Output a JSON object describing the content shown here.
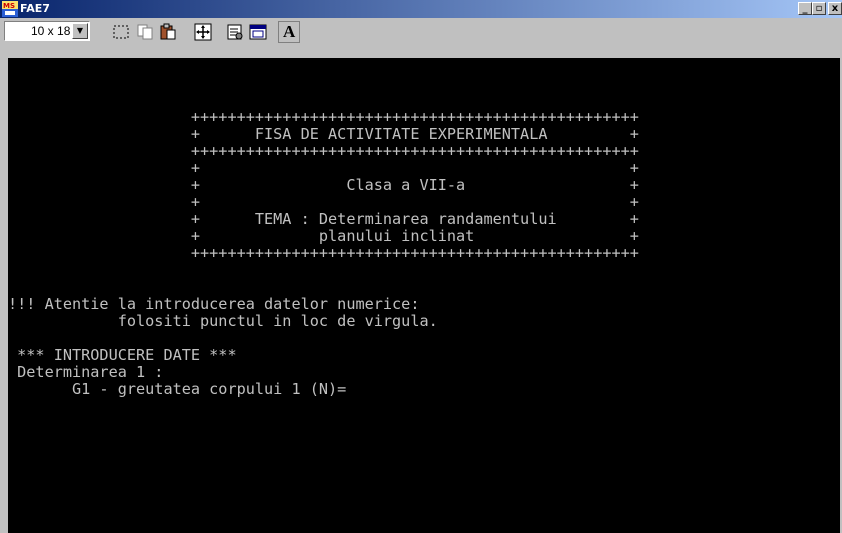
{
  "window": {
    "title": "FAE7",
    "icon_text": "MS"
  },
  "controls": {
    "minimize": "_",
    "maximize": "▫",
    "close": "x"
  },
  "toolbar": {
    "font_size": "10 x 18",
    "buttons": [
      "mark-icon",
      "copy-icon",
      "paste-icon",
      "fullscreen-icon",
      "properties-icon",
      "background-icon",
      "font-icon"
    ],
    "font_button_label": "A"
  },
  "console": {
    "lines": [
      "",
      "",
      "",
      "                    +++++++++++++++++++++++++++++++++++++++++++++++++",
      "                    +      FISA DE ACTIVITATE EXPERIMENTALA         +",
      "                    +++++++++++++++++++++++++++++++++++++++++++++++++",
      "                    +                                               +",
      "                    +                Clasa a VII-a                  +",
      "                    +                                               +",
      "                    +      TEMA : Determinarea randamentului        +",
      "                    +             planului inclinat                 +",
      "                    +++++++++++++++++++++++++++++++++++++++++++++++++",
      "",
      "",
      "!!! Atentie la introducerea datelor numerice:",
      "            folositi punctul in loc de virgula.",
      "",
      " *** INTRODUCERE DATE ***",
      " Determinarea 1 :",
      "       G1 - greutatea corpului 1 (N)="
    ]
  }
}
